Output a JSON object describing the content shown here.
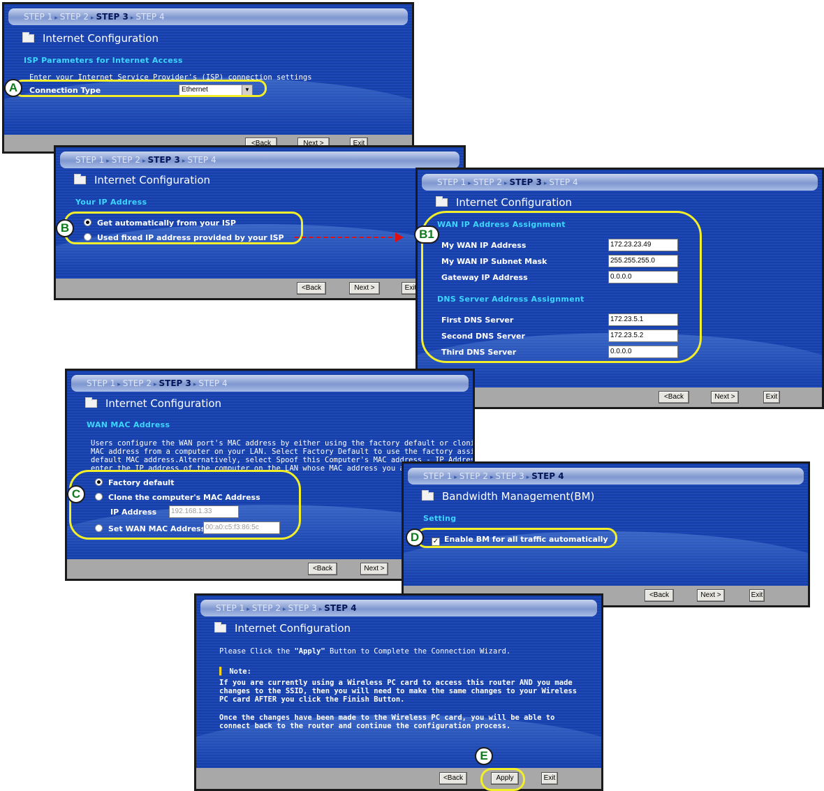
{
  "steps": {
    "s1": "STEP 1",
    "s2": "STEP 2",
    "s3": "STEP 3",
    "s4": "STEP 4",
    "sep": "▸"
  },
  "panelA": {
    "title": "Internet Configuration",
    "section": "ISP Parameters for Internet Access",
    "intro": "Enter your Internet Service Provider's (ISP) connection settings",
    "connection_label": "Connection Type",
    "connection_value": "Ethernet",
    "back": "<Back",
    "next": "Next >",
    "exit": "Exit",
    "badge": "A"
  },
  "panelB": {
    "title": "Internet Configuration",
    "section": "Your IP Address",
    "opt1": "Get automatically from your ISP",
    "opt2": "Used fixed IP address provided by your ISP",
    "back": "<Back",
    "next": "Next >",
    "exit": "Exit",
    "badge": "B"
  },
  "panelB1": {
    "title": "Internet Configuration",
    "wan_section": "WAN IP Address Assignment",
    "wan_ip_label": "My WAN IP Address",
    "wan_ip": "172.23.23.49",
    "mask_label": "My WAN IP Subnet Mask",
    "mask": "255.255.255.0",
    "gw_label": "Gateway IP Address",
    "gw": "0.0.0.0",
    "dns_section": "DNS Server Address Assignment",
    "dns1_label": "First DNS Server",
    "dns1": "172.23.5.1",
    "dns2_label": "Second DNS Server",
    "dns2": "172.23.5.2",
    "dns3_label": "Third DNS Server",
    "dns3": "0.0.0.0",
    "back": "<Back",
    "next": "Next >",
    "exit": "Exit",
    "badge": "B1"
  },
  "panelC": {
    "title": "Internet Configuration",
    "section": "WAN MAC Address",
    "desc1": "Users configure the WAN port's MAC address by either using the factory default or cloning the",
    "desc2": "MAC address from a computer on your LAN. Select Factory Default to use the factory assigned",
    "desc3": "default MAC address.Alternatively, select Spoof this Computer's MAC address - IP Address and",
    "desc4": "enter the IP address of the computer on the LAN whose MAC address you are clo",
    "opt1": "Factory default",
    "opt2": "Clone the computer's MAC Address",
    "ip_label": "IP Address",
    "ip_value": "192.168.1.33",
    "opt3": "Set WAN MAC Address",
    "mac_value": "00:a0:c5:f3:86:5c",
    "back": "<Back",
    "next": "Next >",
    "badge": "C"
  },
  "panelD": {
    "title": "Bandwidth Management(BM)",
    "section": "Setting",
    "check_label": "Enable BM for all traffic automatically",
    "back": "<Back",
    "next": "Next >",
    "exit": "Exit",
    "badge": "D"
  },
  "panelE": {
    "title": "Internet Configuration",
    "line1_pre": "Please Click the ",
    "line1_apply": "\"Apply\"",
    "line1_post": " Button to Complete the Connection Wizard.",
    "note": "Note:",
    "n1": "If you are currently using a Wireless PC card to access this router AND you made",
    "n2": "changes to the SSID, then you will need to make the same changes to your Wireless",
    "n3": "PC card AFTER you click the Finish Button.",
    "n4": "Once the changes have been made to the Wireless PC card, you will be able to",
    "n5": "connect back to the router and continue the configuration process.",
    "back": "<Back",
    "apply": "Apply",
    "exit": "Exit",
    "badge": "E"
  },
  "colors": {
    "panel_bg": "#1b44b0",
    "section": "#3cd6ff",
    "highlight": "#f2ee2a",
    "badge_text": "#0e7a1d",
    "arrow": "#e01010"
  }
}
